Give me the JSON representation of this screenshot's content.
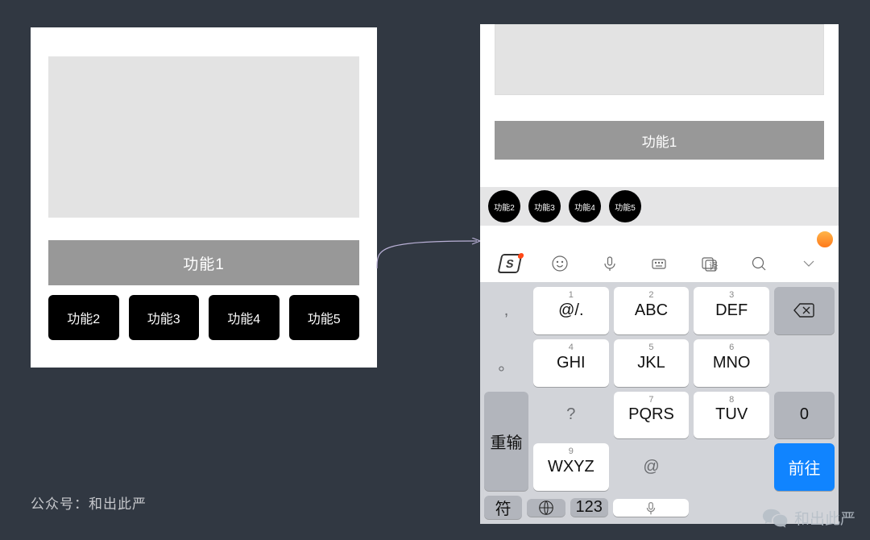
{
  "left": {
    "primary_label": "功能1",
    "chips": [
      "功能2",
      "功能3",
      "功能4",
      "功能5"
    ]
  },
  "right": {
    "primary_label": "功能1",
    "pills": [
      "功能2",
      "功能3",
      "功能4",
      "功能5"
    ]
  },
  "ime_toolbar": {
    "logo_letter": "S",
    "translate_label": "译"
  },
  "keyboard": {
    "left_col": [
      ",",
      "。",
      "?",
      "@"
    ],
    "grid": [
      {
        "sup": "1",
        "main": "@/."
      },
      {
        "sup": "2",
        "main": "ABC"
      },
      {
        "sup": "3",
        "main": "DEF"
      },
      {
        "sup": "4",
        "main": "GHI"
      },
      {
        "sup": "5",
        "main": "JKL"
      },
      {
        "sup": "6",
        "main": "MNO"
      },
      {
        "sup": "7",
        "main": "PQRS"
      },
      {
        "sup": "8",
        "main": "TUV"
      },
      {
        "sup": "9",
        "main": "WXYZ"
      }
    ],
    "right_col": {
      "reenter": "重输",
      "zero": "0"
    },
    "bottom": {
      "symbol": "符",
      "num": "123",
      "go": "前往"
    }
  },
  "credit": "公众号：和出此严",
  "watermark": "和出此严"
}
